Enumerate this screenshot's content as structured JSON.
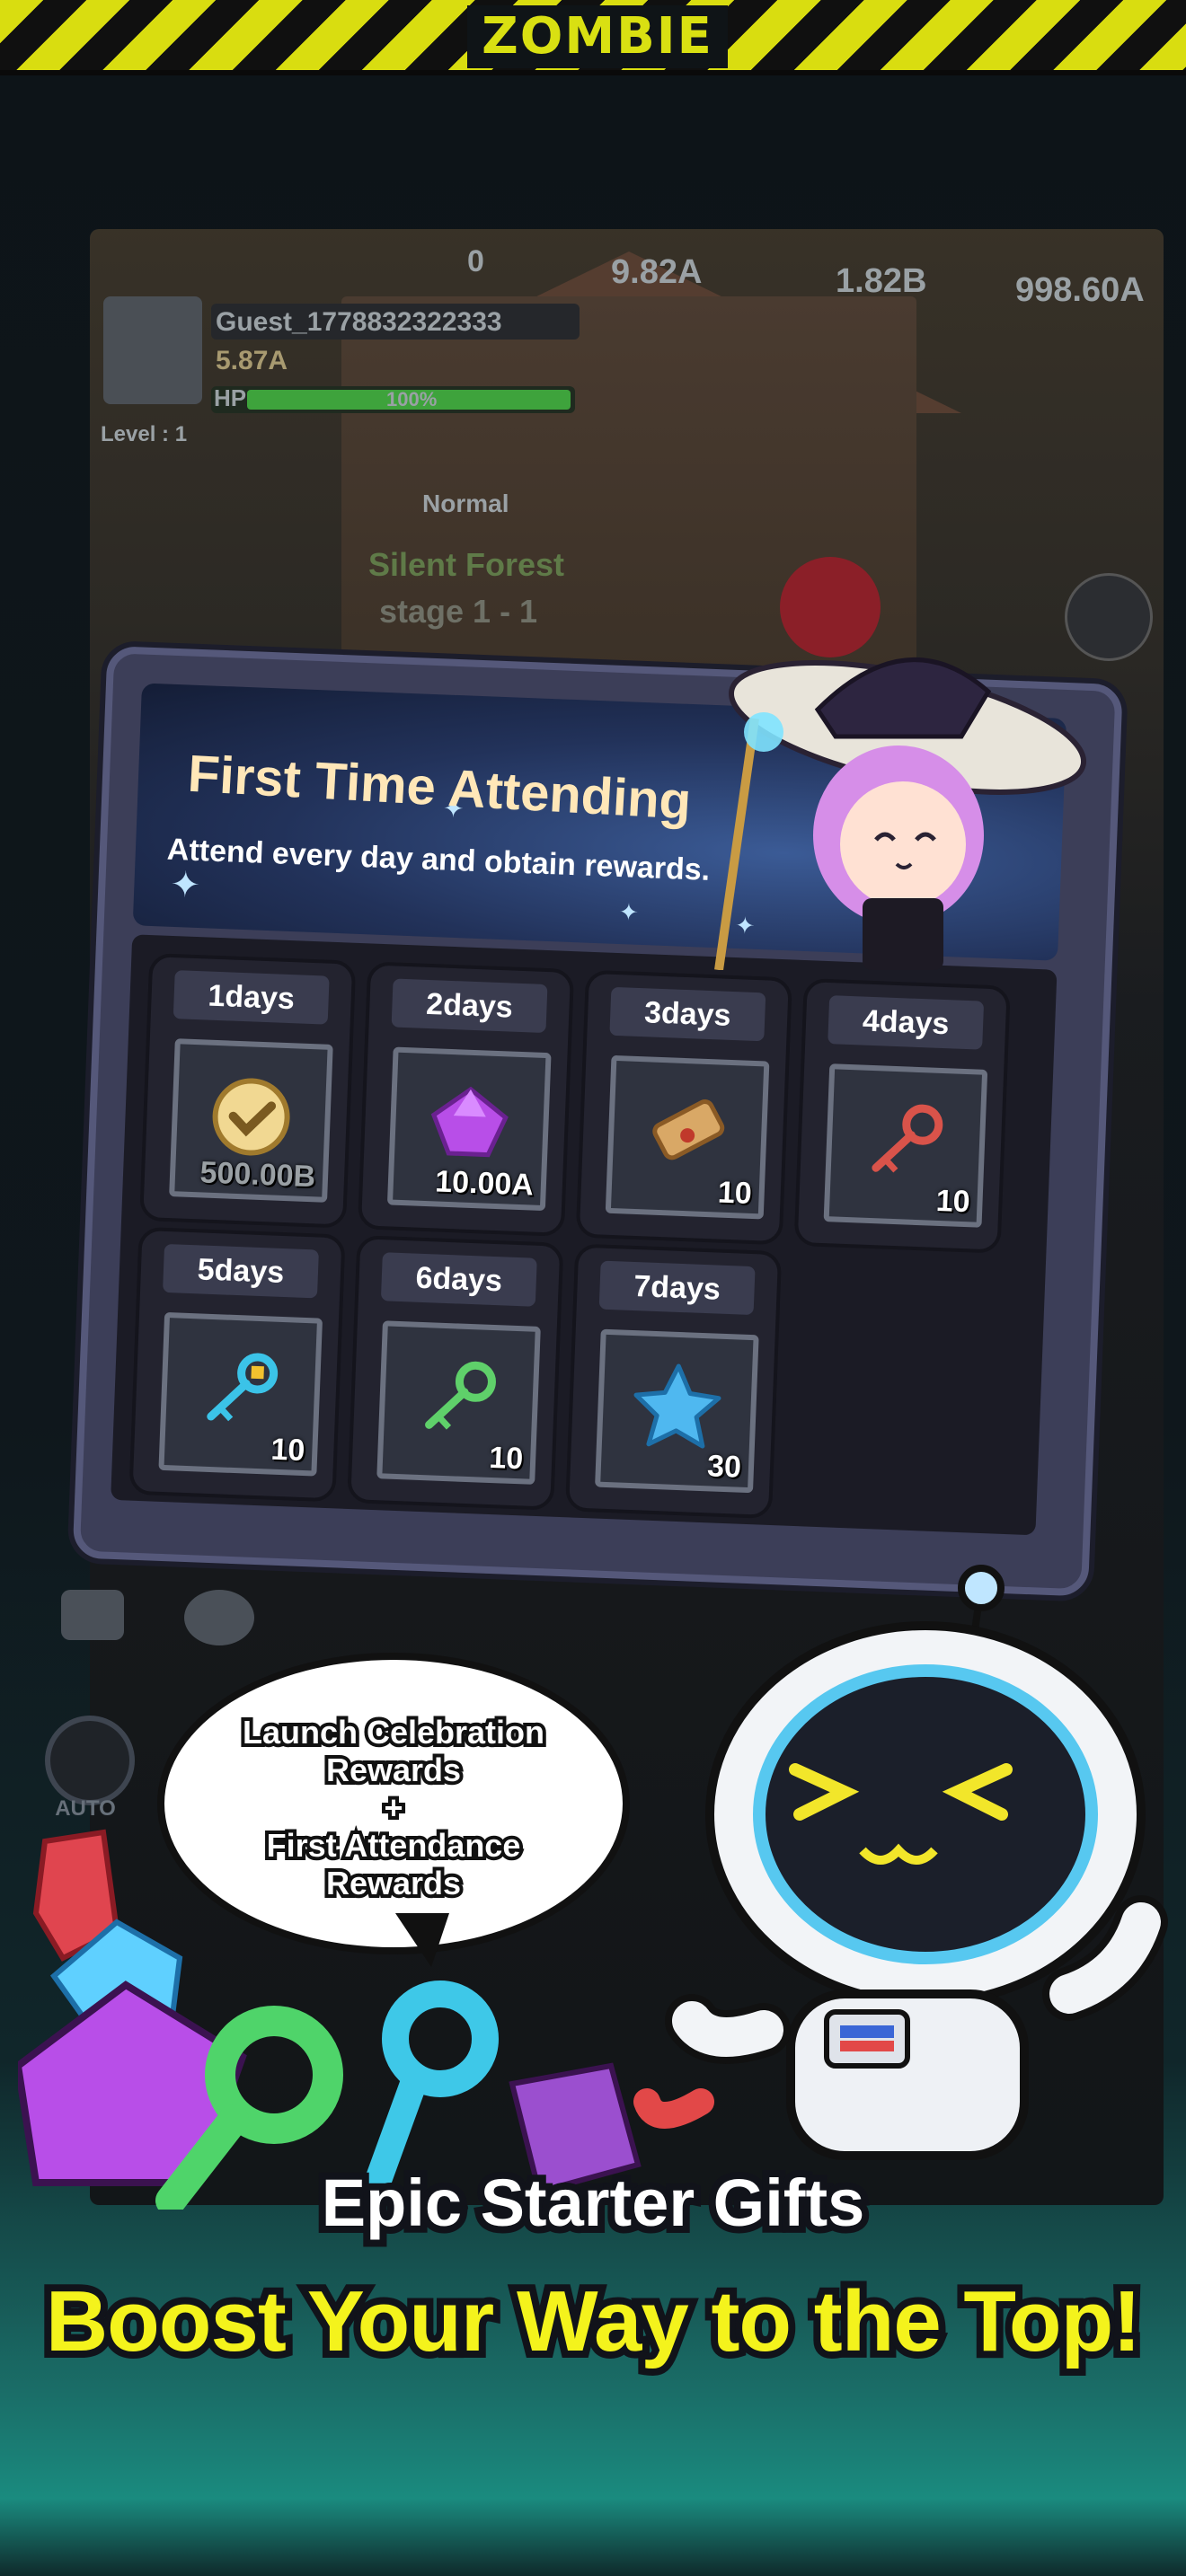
{
  "banner": {
    "title": "ZOMBIE"
  },
  "hud": {
    "counter_zero": "0",
    "currency_1": "9.82A",
    "currency_2": "1.82B",
    "currency_3": "998.60A",
    "player_name": "Guest_1778832322333",
    "attack_power": "5.87A",
    "hp_label": "HP",
    "hp_percent": "100%",
    "hp_fraction": 1.0,
    "level": "Level : 1",
    "difficulty": "Normal",
    "area_name": "Silent Forest",
    "stage": "stage 1 - 1",
    "auto_label": "AUTO"
  },
  "dialog": {
    "title": "First Time Attending",
    "subtitle": "Attend every day and obtain rewards.",
    "rewards": [
      {
        "day": "1days",
        "amount": "500.00B",
        "icon": "check-coin-icon",
        "claimed": true
      },
      {
        "day": "2days",
        "amount": "10.00A",
        "icon": "purple-gem-icon",
        "claimed": false
      },
      {
        "day": "3days",
        "amount": "10",
        "icon": "scroll-icon",
        "claimed": false
      },
      {
        "day": "4days",
        "amount": "10",
        "icon": "red-key-icon",
        "claimed": false
      },
      {
        "day": "5days",
        "amount": "10",
        "icon": "blue-key-icon",
        "claimed": false
      },
      {
        "day": "6days",
        "amount": "10",
        "icon": "green-key-icon",
        "claimed": false
      },
      {
        "day": "7days",
        "amount": "30",
        "icon": "blue-star-icon",
        "claimed": false
      }
    ]
  },
  "bubble": {
    "line1": "Launch Celebration",
    "line2": "Rewards",
    "line3": "+",
    "line4": "First Attendance",
    "line5": "Rewards"
  },
  "slogan": {
    "line1": "Epic Starter Gifts",
    "line2": "Boost Your Way to the Top!"
  },
  "colors": {
    "tape_yellow": "#d9dd10",
    "slogan_yellow": "#f4f31c",
    "title_cream": "#ffe7b8",
    "dialog_frame": "#3c3e58"
  }
}
